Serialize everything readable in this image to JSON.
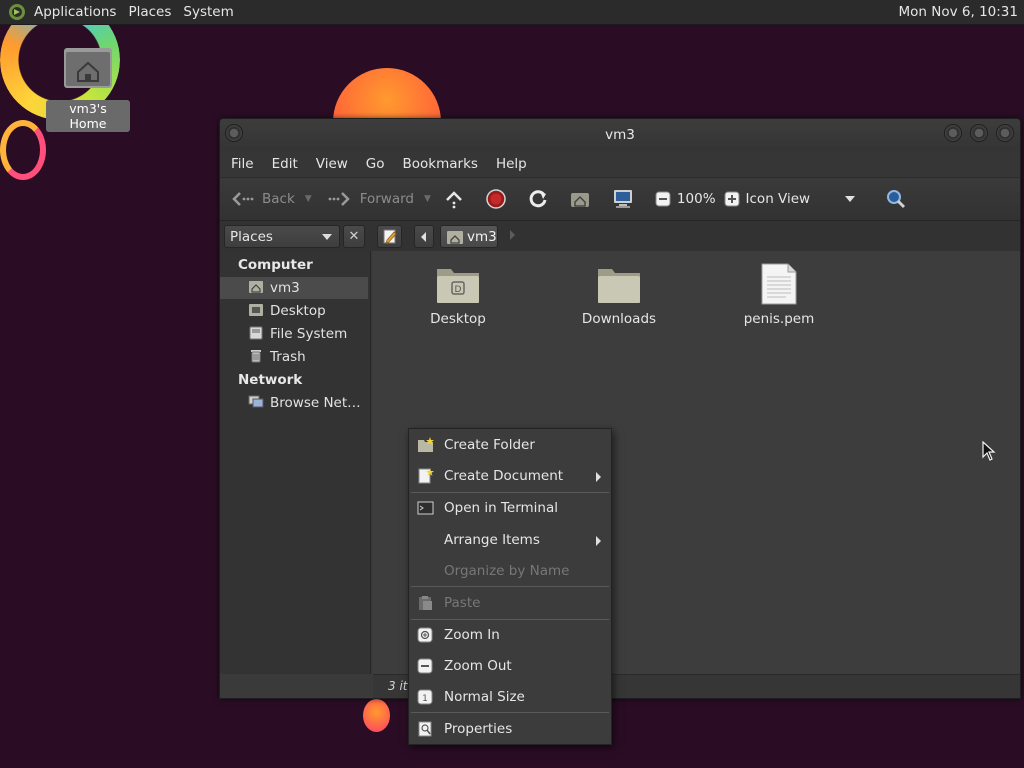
{
  "panel": {
    "menus": [
      "Applications",
      "Places",
      "System"
    ],
    "clock": "Mon Nov  6, 10:31"
  },
  "desktop": {
    "home_icon_label": "vm3's Home"
  },
  "window": {
    "title": "vm3",
    "menu": [
      "File",
      "Edit",
      "View",
      "Go",
      "Bookmarks",
      "Help"
    ],
    "toolbar": {
      "back": "Back",
      "forward": "Forward",
      "zoom": "100%",
      "view_mode": "Icon View"
    },
    "places_label": "Places",
    "breadcrumb": "vm3",
    "sidebar": {
      "computer_header": "Computer",
      "computer_items": [
        "vm3",
        "Desktop",
        "File System",
        "Trash"
      ],
      "network_header": "Network",
      "network_items": [
        "Browse Net…"
      ]
    },
    "files": [
      {
        "name": "Desktop",
        "icon": "folder-desktop-icon"
      },
      {
        "name": "Downloads",
        "icon": "folder-icon"
      },
      {
        "name": "penis.pem",
        "icon": "text-file-icon"
      }
    ],
    "status": "3 ite"
  },
  "context_menu": {
    "items": [
      {
        "label": "Create Folder",
        "icon": "folder-new-icon",
        "enabled": true
      },
      {
        "label": "Create Document",
        "icon": "document-new-icon",
        "enabled": true,
        "submenu": true
      },
      {
        "label": "Open in Terminal",
        "icon": "terminal-icon",
        "enabled": true
      },
      {
        "label": "Arrange Items",
        "enabled": true,
        "submenu": true
      },
      {
        "label": "Organize by Name",
        "enabled": false
      },
      {
        "label": "Paste",
        "icon": "paste-icon",
        "enabled": false
      },
      {
        "label": "Zoom In",
        "icon": "zoom-in-icon",
        "enabled": true
      },
      {
        "label": "Zoom Out",
        "icon": "zoom-out-icon",
        "enabled": true
      },
      {
        "label": "Normal Size",
        "icon": "zoom-normal-icon",
        "enabled": true
      },
      {
        "label": "Properties",
        "icon": "properties-icon",
        "enabled": true
      }
    ]
  },
  "colors": {
    "desktop_bg": "#2a0d24",
    "window_bg": "#3d3d3d",
    "accent_blue": "#4a90d9"
  }
}
